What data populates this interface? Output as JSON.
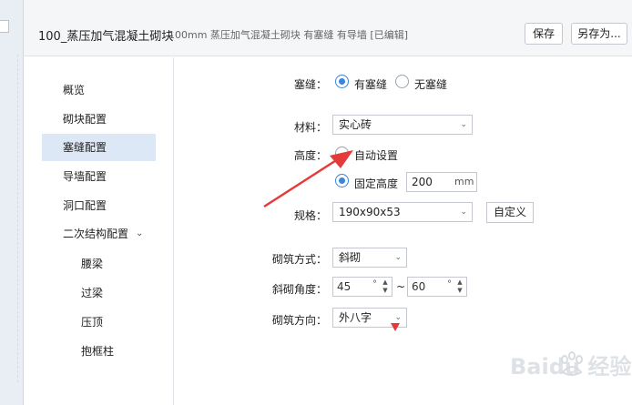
{
  "header": {
    "title": "100_蒸压加气混凝土砌块",
    "subtitle": "100mm 蒸压加气混凝土砌块 有塞缝 有导墙 [已编辑]",
    "save_label": "保存",
    "saveas_label": "另存为..."
  },
  "nav": {
    "items": [
      {
        "label": "概览"
      },
      {
        "label": "砌块配置"
      },
      {
        "label": "塞缝配置"
      },
      {
        "label": "导墙配置"
      },
      {
        "label": "洞口配置"
      },
      {
        "label": "二次结构配置"
      }
    ],
    "subitems": [
      {
        "label": "腰梁"
      },
      {
        "label": "过梁"
      },
      {
        "label": "压顶"
      },
      {
        "label": "抱框柱"
      }
    ]
  },
  "form": {
    "seam_label": "塞缝：",
    "seam_yes": "有塞缝",
    "seam_no": "无塞缝",
    "material_label": "材料：",
    "material_value": "实心砖",
    "height_label": "高度：",
    "height_auto": "自动设置",
    "height_fixed": "固定高度",
    "height_value": "200",
    "height_unit": "mm",
    "spec_label": "规格：",
    "spec_value": "190x90x53",
    "custom_label": "自定义",
    "method_label": "砌筑方式：",
    "method_value": "斜砌",
    "angle_label": "斜砌角度：",
    "angle_from": "45",
    "angle_to": "60",
    "angle_unit": "°",
    "angle_sep": "~",
    "direction_label": "砌筑方向：",
    "direction_value": "外八字"
  },
  "watermark": {
    "text": "Baidu 经验"
  },
  "colors": {
    "accent": "#3a86d8",
    "active_nav": "#dde8f6",
    "annotation": "#e53a3a"
  }
}
